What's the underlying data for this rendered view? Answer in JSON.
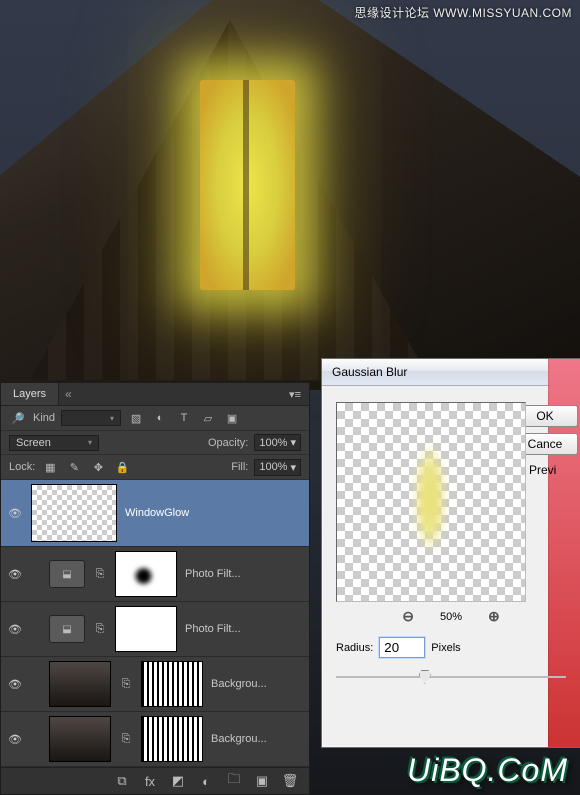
{
  "watermarks": {
    "top": "思缘设计论坛  WWW.MISSYUAN.COM",
    "bottom": "UiBQ.CoM"
  },
  "layers_panel": {
    "title": "Layers",
    "kind_label": "Kind",
    "kind_value": "⌄",
    "blend_mode": "Screen",
    "opacity_label": "Opacity:",
    "opacity_value": "100%",
    "lock_label": "Lock:",
    "fill_label": "Fill:",
    "fill_value": "100%",
    "layers": [
      {
        "name": "WindowGlow"
      },
      {
        "name": "Photo Filt..."
      },
      {
        "name": "Photo Filt..."
      },
      {
        "name": "Backgrou..."
      },
      {
        "name": "Backgrou..."
      }
    ]
  },
  "gaussian_dialog": {
    "title": "Gaussian Blur",
    "zoom_pct": "50%",
    "radius_label": "Radius:",
    "radius_value": "20",
    "radius_unit": "Pixels",
    "ok": "OK",
    "cancel": "Cance",
    "preview": "Previ"
  }
}
